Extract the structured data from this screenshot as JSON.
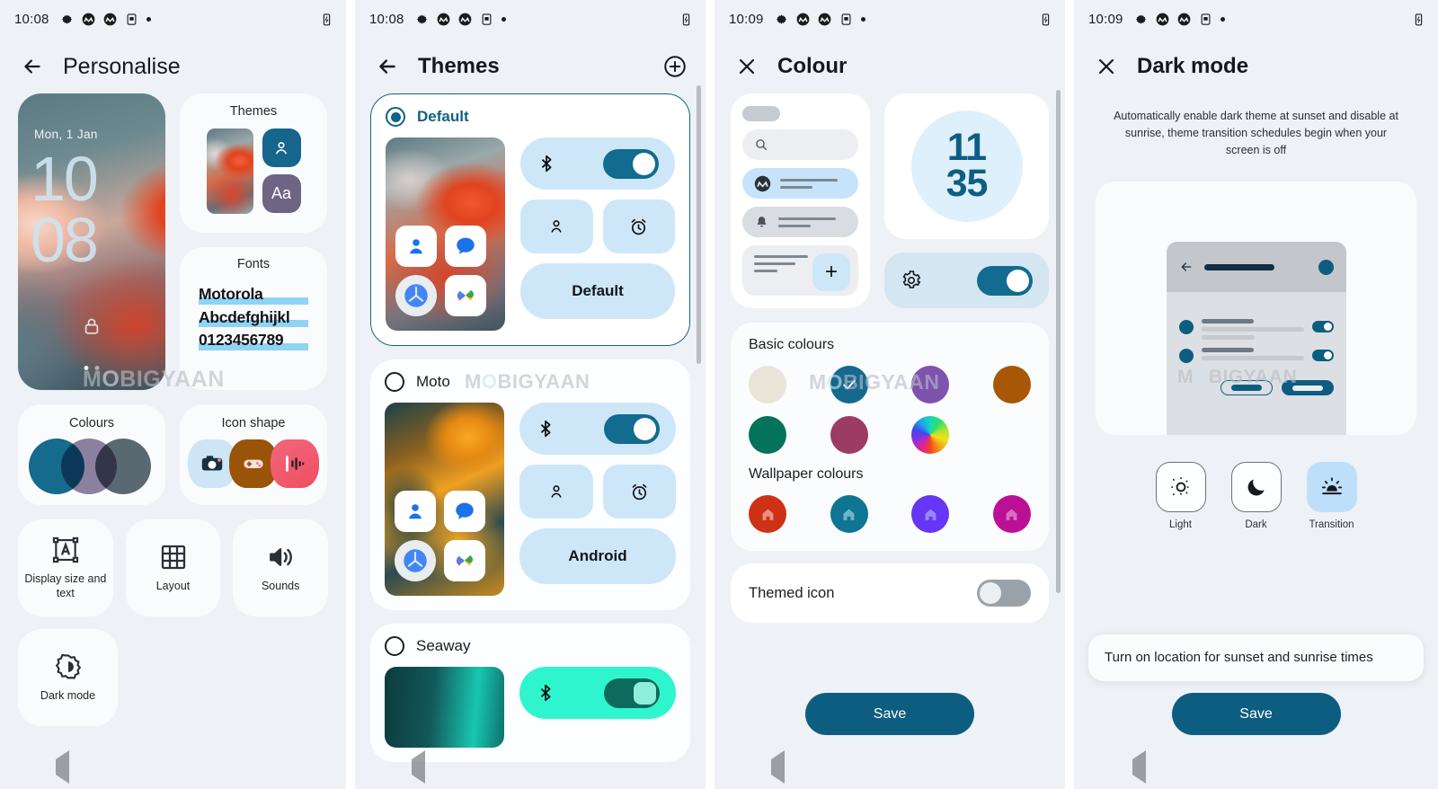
{
  "screens": {
    "personalise": {
      "status": {
        "time": "10:08"
      },
      "title": "Personalise",
      "back_icon": "arrow-left-icon",
      "wallpaper": {
        "date": "Mon, 1 Jan",
        "hour": "10",
        "minute": "08",
        "lock_icon": "lock-icon"
      },
      "themes_card": {
        "label": "Themes",
        "font_tile": "Aa",
        "person_icon": "person-icon"
      },
      "fonts_card": {
        "label": "Fonts",
        "line1": "Motorola",
        "line2": "Abcdefghijkl",
        "line3": "0123456789"
      },
      "colours_card": {
        "label": "Colours"
      },
      "icon_shape_card": {
        "label": "Icon shape"
      },
      "tiles": [
        {
          "label": "Display size and text",
          "icon": "display-size-icon"
        },
        {
          "label": "Layout",
          "icon": "grid-layout-icon"
        },
        {
          "label": "Sounds",
          "icon": "volume-icon"
        },
        {
          "label": "Dark mode",
          "icon": "brightness-icon"
        }
      ]
    },
    "themes": {
      "status": {
        "time": "10:08"
      },
      "title": "Themes",
      "back_icon": "arrow-left-icon",
      "add_icon": "plus-circle-icon",
      "items": [
        {
          "name": "Default",
          "selected": true,
          "word": "Default"
        },
        {
          "name": "Moto",
          "selected": false,
          "word": "Android"
        },
        {
          "name": "Seaway",
          "selected": false,
          "word": ""
        }
      ]
    },
    "colour": {
      "status": {
        "time": "10:09"
      },
      "title": "Colour",
      "close_icon": "close-icon",
      "clock_preview": {
        "hour": "11",
        "minute": "35"
      },
      "basic_colours_label": "Basic colours",
      "basic_colours": [
        {
          "hex": "#eae4d8",
          "selected": false
        },
        {
          "hex": "#15698e",
          "selected": true
        },
        {
          "hex": "#7e53ad",
          "selected": false
        },
        {
          "hex": "#a75706",
          "selected": false
        },
        {
          "hex": "#05735b",
          "selected": false
        },
        {
          "hex": "#9c3c62",
          "selected": false
        },
        {
          "hex": "wheel",
          "selected": false
        }
      ],
      "wallpaper_colours_label": "Wallpaper colours",
      "wallpaper_colours": [
        "#ce3113",
        "#0e7593",
        "#6536f5",
        "#bb1096"
      ],
      "themed_icon": {
        "label": "Themed icon",
        "enabled": false
      },
      "save_label": "Save"
    },
    "dark_mode": {
      "status": {
        "time": "10:09"
      },
      "title": "Dark mode",
      "close_icon": "close-icon",
      "description": "Automatically enable dark theme at sunset and disable at sunrise, theme transition schedules begin when your screen is off",
      "modes": [
        {
          "label": "Light",
          "icon": "sun-icon",
          "active": false
        },
        {
          "label": "Dark",
          "icon": "moon-icon",
          "active": false
        },
        {
          "label": "Transition",
          "icon": "sunset-icon",
          "active": true
        }
      ],
      "toast": "Turn on location for sunset and sunrise times",
      "save_label": "Save"
    }
  },
  "watermark": "MOBIGYAAN",
  "nav": {
    "back_icon": "nav-back-triangle",
    "home_icon": "nav-home-circle",
    "recents_icon": "nav-recents-square"
  }
}
